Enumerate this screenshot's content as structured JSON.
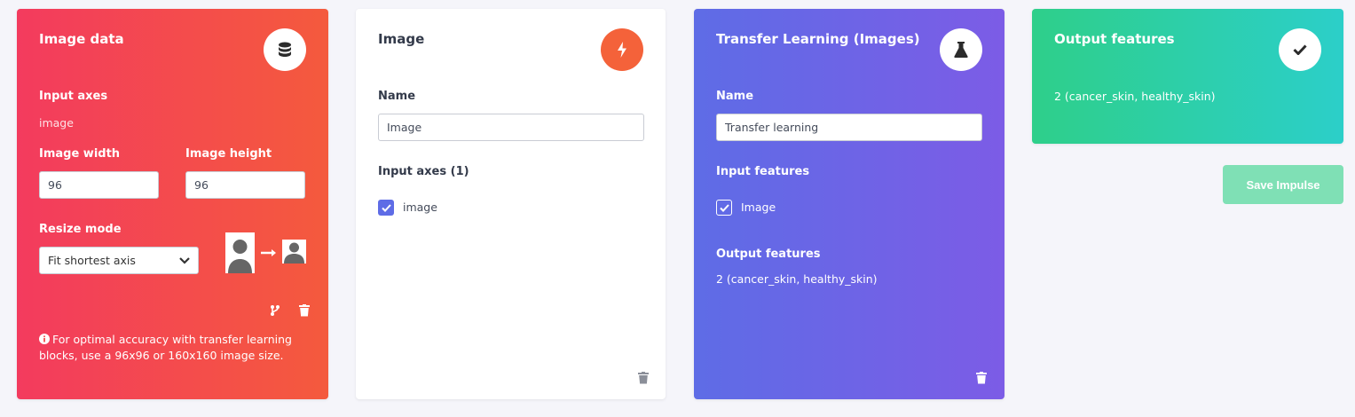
{
  "image_data_block": {
    "title": "Image data",
    "icon": "database-icon",
    "input_axes_label": "Input axes",
    "input_axes_value": "image",
    "width_label": "Image width",
    "width_value": "96",
    "height_label": "Image height",
    "height_value": "96",
    "resize_label": "Resize mode",
    "resize_value": "Fit shortest axis",
    "info_text": "For optimal accuracy with transfer learning blocks, use a 96x96 or 160x160 image size.",
    "color_start": "#f33b5e",
    "color_end": "#f45a3d"
  },
  "image_block": {
    "title": "Image",
    "icon": "lightning-icon",
    "icon_color": "#f4623a",
    "name_label": "Name",
    "name_value": "Image",
    "input_axes_label": "Input axes (1)",
    "axes": [
      {
        "label": "image",
        "checked": true
      }
    ]
  },
  "transfer_block": {
    "title": "Transfer Learning (Images)",
    "icon": "flask-icon",
    "name_label": "Name",
    "name_value": "Transfer learning",
    "input_features_label": "Input features",
    "features": [
      {
        "label": "Image",
        "checked": true
      }
    ],
    "output_features_label": "Output features",
    "output_features_value": "2 (cancer_skin, healthy_skin)",
    "color_start": "#5e6ce6",
    "color_end": "#7c5ce6"
  },
  "output_block": {
    "title": "Output features",
    "icon": "checkmark-icon",
    "value": "2 (cancer_skin, healthy_skin)",
    "color_start": "#2ecf8a",
    "color_end": "#2ccfc9"
  },
  "save_button": {
    "label": "Save Impulse",
    "color": "#7fe0b5"
  }
}
